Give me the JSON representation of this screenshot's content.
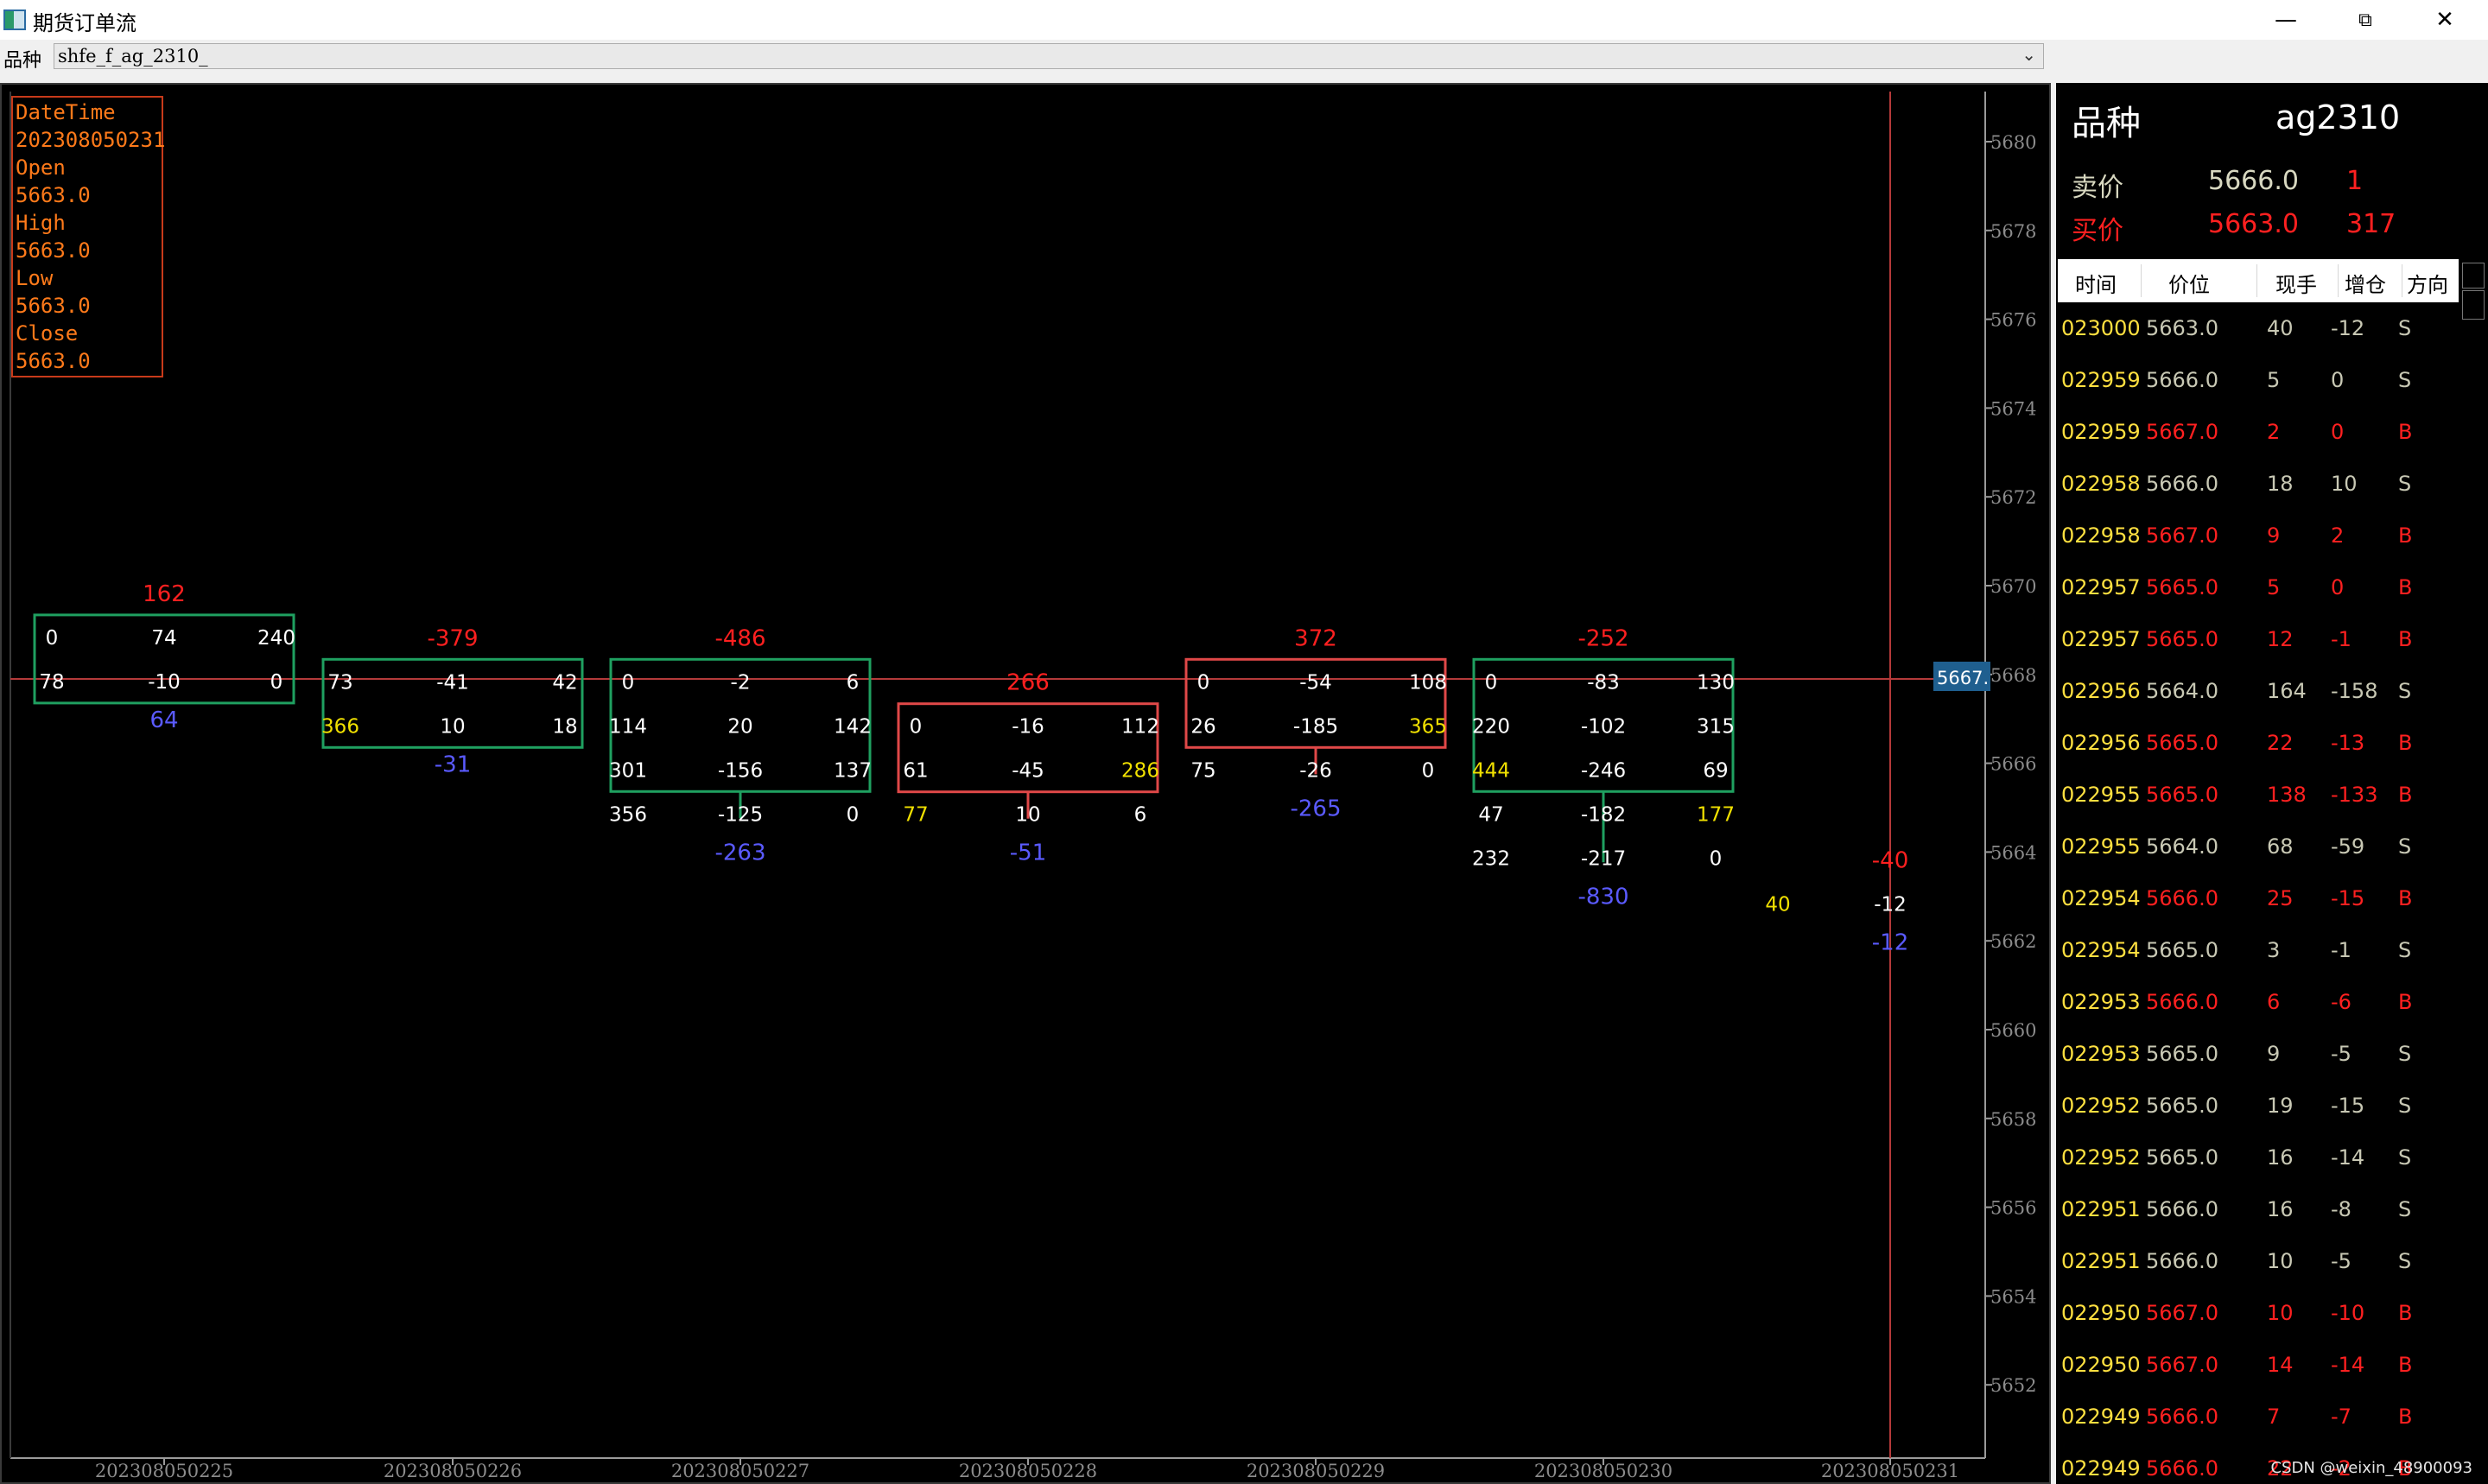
{
  "window": {
    "title": "期货订单流",
    "minimize": "—",
    "restore": "⧉",
    "close": "✕"
  },
  "selector": {
    "label": "品种",
    "value": "shfe_f_ag_2310_"
  },
  "info_box": [
    "DateTime",
    "202308050231",
    "Open",
    "5663.0",
    "High",
    "5663.0",
    "Low",
    "5663.0",
    "Close",
    "5663.0"
  ],
  "chart_data": {
    "type": "table",
    "price_axis": {
      "ticks": [
        5680,
        5678,
        5676,
        5674,
        5672,
        5670,
        5668,
        5666,
        5664,
        5662,
        5660,
        5658,
        5656,
        5654,
        5652
      ],
      "current_label": "5667."
    },
    "time_labels": [
      "202308050225",
      "202308050226",
      "202308050227",
      "202308050228",
      "202308050229",
      "202308050230",
      "202308050231"
    ],
    "bars": [
      {
        "time": "202308050225",
        "delta": "162",
        "total": "64",
        "box": "green",
        "top_price": 5669,
        "rows": [
          [
            "0",
            "74",
            "240"
          ],
          [
            "78",
            "-10",
            "0"
          ]
        ],
        "boxed_rows": 2
      },
      {
        "time": "202308050226",
        "delta": "-379",
        "total": "-31",
        "box": "green",
        "top_price": 5668,
        "rows": [
          [
            "73",
            "-41",
            "42"
          ],
          [
            "366",
            "10",
            "18"
          ]
        ],
        "boxed_rows": 2
      },
      {
        "time": "202308050227",
        "delta": "-486",
        "total": "-263",
        "box": "green",
        "top_price": 5668,
        "rows": [
          [
            "0",
            "-2",
            "6"
          ],
          [
            "114",
            "20",
            "142"
          ],
          [
            "301",
            "-156",
            "137"
          ],
          [
            "356",
            "-125",
            "0"
          ]
        ],
        "boxed_rows": 3
      },
      {
        "time": "202308050228",
        "delta": "266",
        "total": "-51",
        "box": "red",
        "top_price": 5667,
        "rows": [
          [
            "0",
            "-16",
            "112"
          ],
          [
            "61",
            "-45",
            "286"
          ],
          [
            "77",
            "10",
            "6"
          ]
        ],
        "boxed_rows": 2
      },
      {
        "time": "202308050229",
        "delta": "372",
        "total": "-265",
        "box": "red",
        "top_price": 5668,
        "rows": [
          [
            "0",
            "-54",
            "108"
          ],
          [
            "26",
            "-185",
            "365"
          ],
          [
            "75",
            "-26",
            "0"
          ]
        ],
        "boxed_rows": 2
      },
      {
        "time": "202308050230",
        "delta": "-252",
        "total": "-830",
        "box": "green",
        "top_price": 5668,
        "rows": [
          [
            "0",
            "-83",
            "130"
          ],
          [
            "220",
            "-102",
            "315"
          ],
          [
            "444",
            "-246",
            "69"
          ],
          [
            "47",
            "-182",
            "177"
          ],
          [
            "232",
            "-217",
            "0"
          ]
        ],
        "boxed_rows": 3
      },
      {
        "time": "202308050231",
        "delta": "-40",
        "total": "-12",
        "box": "none",
        "top_price": 5663,
        "rows": [
          [
            "40",
            "-12",
            ""
          ]
        ],
        "boxed_rows": 0
      }
    ],
    "yellow_rule": "sell ≥ 3× buy or buy ≥ 3× sell highlighted"
  },
  "quote": {
    "symbol_label": "品种",
    "symbol": "ag2310",
    "ask_label": "卖价",
    "ask_price": "5666.0",
    "ask_vol": "1",
    "bid_label": "买价",
    "bid_price": "5663.0",
    "bid_vol": "317"
  },
  "ticks_header": [
    "时间",
    "价位",
    "现手",
    "增仓",
    "方向"
  ],
  "ticks": [
    [
      "023000",
      "5663.0",
      "40",
      "-12",
      "S"
    ],
    [
      "022959",
      "5666.0",
      "5",
      "0",
      "S"
    ],
    [
      "022959",
      "5667.0",
      "2",
      "0",
      "B"
    ],
    [
      "022958",
      "5666.0",
      "18",
      "10",
      "S"
    ],
    [
      "022958",
      "5667.0",
      "9",
      "2",
      "B"
    ],
    [
      "022957",
      "5665.0",
      "5",
      "0",
      "B"
    ],
    [
      "022957",
      "5665.0",
      "12",
      "-1",
      "B"
    ],
    [
      "022956",
      "5664.0",
      "164",
      "-158",
      "S"
    ],
    [
      "022956",
      "5665.0",
      "22",
      "-13",
      "B"
    ],
    [
      "022955",
      "5665.0",
      "138",
      "-133",
      "B"
    ],
    [
      "022955",
      "5664.0",
      "68",
      "-59",
      "S"
    ],
    [
      "022954",
      "5666.0",
      "25",
      "-15",
      "B"
    ],
    [
      "022954",
      "5665.0",
      "3",
      "-1",
      "S"
    ],
    [
      "022953",
      "5666.0",
      "6",
      "-6",
      "B"
    ],
    [
      "022953",
      "5665.0",
      "9",
      "-5",
      "S"
    ],
    [
      "022952",
      "5665.0",
      "19",
      "-15",
      "S"
    ],
    [
      "022952",
      "5665.0",
      "16",
      "-14",
      "S"
    ],
    [
      "022951",
      "5666.0",
      "16",
      "-8",
      "S"
    ],
    [
      "022951",
      "5666.0",
      "10",
      "-5",
      "S"
    ],
    [
      "022950",
      "5667.0",
      "10",
      "-10",
      "B"
    ],
    [
      "022950",
      "5667.0",
      "14",
      "-14",
      "B"
    ],
    [
      "022949",
      "5666.0",
      "7",
      "-7",
      "B"
    ],
    [
      "022949",
      "5666.0",
      "22",
      "-2",
      "B"
    ]
  ],
  "colors": {
    "buy": "#ff2020",
    "sell": "#c8c8b4",
    "time": "#ffe040",
    "green_box": "#1fa060",
    "red_box": "#e04848",
    "total": "#5a5aff",
    "delta_pos": "#ff2020",
    "delta_neg": "#ff2020",
    "highlight": "#f0e000"
  },
  "watermark": "CSDN @weixin_48900093"
}
